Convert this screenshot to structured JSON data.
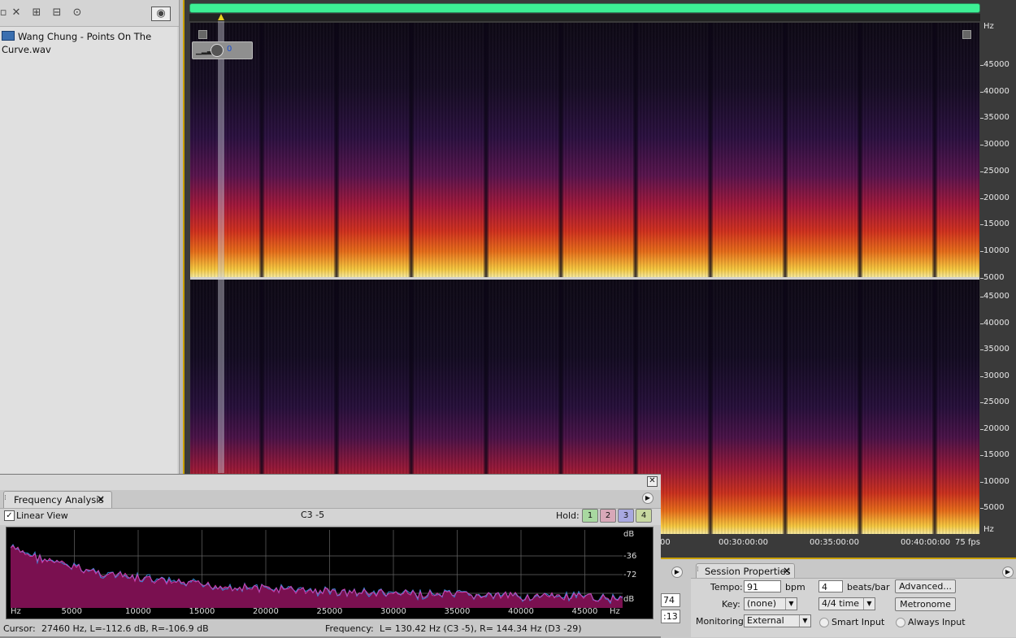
{
  "files": {
    "filename": "Wang Chung - Points On The Curve.wav"
  },
  "editor": {
    "amplitude_value": "0",
    "freq_scale": {
      "unit": "Hz",
      "ch1": [
        "45000",
        "40000",
        "35000",
        "30000",
        "25000",
        "20000",
        "15000",
        "10000",
        "5000"
      ],
      "ch2": [
        "45000",
        "40000",
        "35000",
        "30000",
        "25000",
        "20000",
        "15000",
        "10000",
        "5000"
      ],
      "bottom_unit": "Hz"
    },
    "time_ruler": {
      "partial_label": "00",
      "labels": [
        "00:30:00:00",
        "00:35:00:00",
        "00:40:00:00"
      ],
      "fps": "75 fps"
    }
  },
  "frequency_analysis": {
    "tab_label": "Frequency Analysis",
    "close_label": "×",
    "linear_view_label": "Linear View",
    "linear_view_checked": true,
    "note": "C3 -5",
    "hold_label": "Hold:",
    "hold_buttons": [
      {
        "label": "1",
        "color": "#a8d8a0"
      },
      {
        "label": "2",
        "color": "#d8a8b8"
      },
      {
        "label": "3",
        "color": "#a8a8e0"
      },
      {
        "label": "4",
        "color": "#c8d8a0"
      }
    ],
    "db_labels": [
      "dB",
      "-36",
      "-72",
      "dB"
    ],
    "hz_labels": [
      "Hz",
      "5000",
      "10000",
      "15000",
      "20000",
      "25000",
      "30000",
      "35000",
      "40000",
      "45000",
      "Hz"
    ],
    "cursor_label": "Cursor:",
    "cursor_value": "27460 Hz, L=-112.6 dB, R=-106.9 dB",
    "frequency_label": "Frequency:",
    "frequency_value": "L= 130.42 Hz (C3 -5), R= 144.34 Hz (D3 -29)"
  },
  "mini_fields": [
    "74",
    ":13"
  ],
  "session_properties": {
    "tab_label": "Session Properties",
    "close_label": "×",
    "tempo_label": "Tempo:",
    "tempo_value": "91",
    "bpm_label": "bpm",
    "beats_value": "4",
    "beats_label": "beats/bar",
    "advanced_button": "Advanced...",
    "key_label": "Key:",
    "key_value": "(none)",
    "time_value": "4/4 time",
    "metronome_button": "Metronome",
    "monitoring_label": "Monitoring:",
    "monitoring_value": "External",
    "smart_input_label": "Smart Input",
    "always_input_label": "Always Input"
  },
  "colors": {
    "overview": "#3df095",
    "accent_gold": "#c9a000",
    "spectrum_fill": "#7a1050",
    "spectrum_line": "#3a8ad8"
  }
}
